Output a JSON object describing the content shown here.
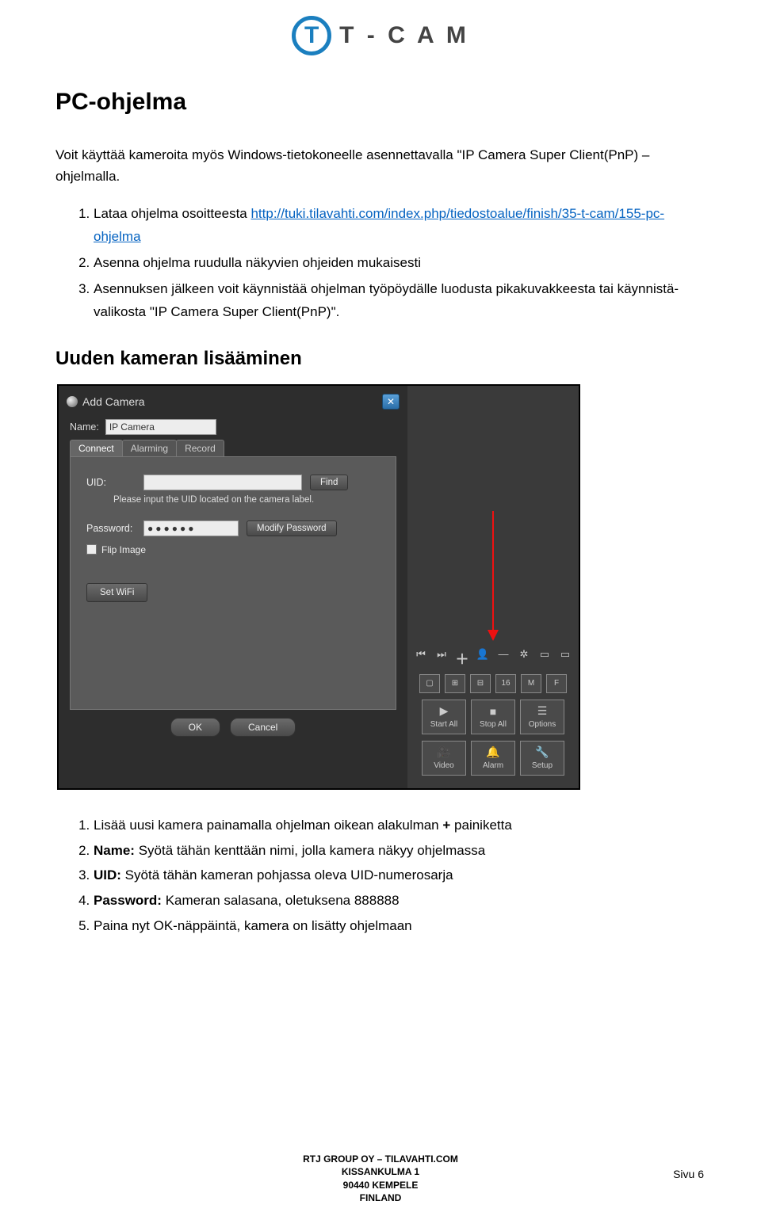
{
  "logo": {
    "mark": "T",
    "text": "T - C A M"
  },
  "h1": "PC-ohjelma",
  "intro": "Voit käyttää kameroita myös Windows-tietokoneelle asennettavalla \"IP Camera Super Client(PnP) – ohjelmalla.",
  "steps1": {
    "i1a": "Lataa ohjelma osoitteesta ",
    "i1_link": "http://tuki.tilavahti.com/index.php/tiedostoalue/finish/35-t-cam/155-pc-ohjelma",
    "i2": "Asenna ohjelma ruudulla näkyvien ohjeiden mukaisesti",
    "i3": "Asennuksen jälkeen voit käynnistää ohjelman työpöydälle luodusta pikakuvakkeesta tai käynnistä-valikosta \"IP Camera Super Client(PnP)\"."
  },
  "h2": "Uuden kameran lisääminen",
  "dialog": {
    "title": "Add Camera",
    "name_label": "Name:",
    "name_value": "IP Camera",
    "tabs": {
      "connect": "Connect",
      "alarming": "Alarming",
      "record": "Record"
    },
    "uid_label": "UID:",
    "find": "Find",
    "uid_hint": "Please input the UID located on the camera label.",
    "pwd_label": "Password:",
    "pwd_value": "●●●●●●",
    "mod_pwd": "Modify Password",
    "flip": "Flip Image",
    "set_wifi": "Set WiFi",
    "ok": "OK",
    "cancel": "Cancel"
  },
  "side": {
    "nav": {
      "first": "⏮",
      "last": "⏭",
      "plus": "＋",
      "person": "👤",
      "minus": "—",
      "gear": "✲",
      "win1": "▭",
      "win2": "▭"
    },
    "layouts": {
      "one": "▢",
      "four": "⊞",
      "nine": "⊟",
      "sixteen": "16",
      "m": "M",
      "f": "F"
    },
    "actions": {
      "start_all": "Start All",
      "stop_all": "Stop All",
      "options": "Options",
      "video": "Video",
      "alarm": "Alarm",
      "setup": "Setup"
    }
  },
  "steps2": {
    "i1a": "Lisää uusi kamera painamalla ohjelman oikean alakulman ",
    "i1b": "+",
    "i1c": " painiketta",
    "i2a": "Name:",
    "i2b": " Syötä tähän kenttään nimi, jolla kamera näkyy ohjelmassa",
    "i3a": "UID:",
    "i3b": " Syötä tähän kameran pohjassa oleva UID-numerosarja",
    "i4a": "Password:",
    "i4b": " Kameran salasana, oletuksena 888888",
    "i5": "Paina nyt OK-näppäintä, kamera on lisätty ohjelmaan"
  },
  "footer": {
    "l1": "RTJ GROUP OY – TILAVAHTI.COM",
    "l2": "KISSANKULMA 1",
    "l3": "90440 KEMPELE",
    "l4": "FINLAND"
  },
  "page_num": "Sivu 6"
}
